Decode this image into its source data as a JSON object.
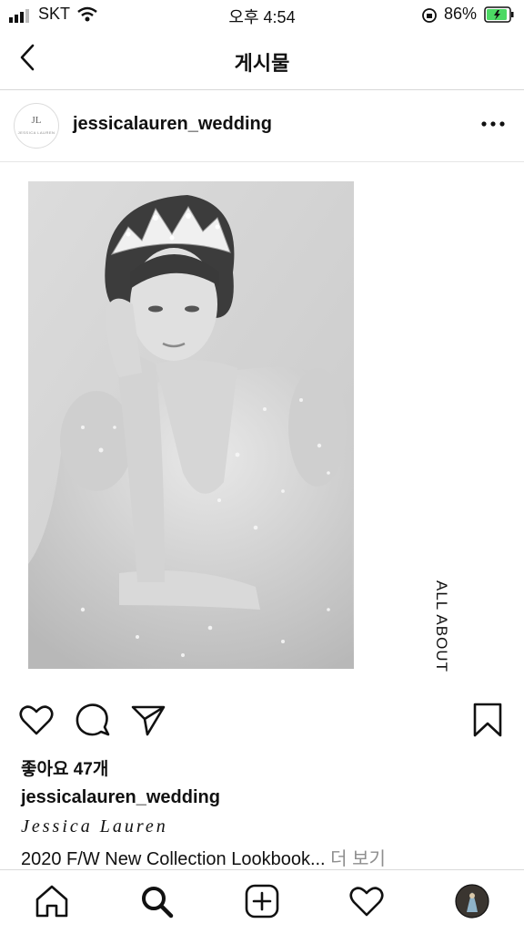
{
  "status_bar": {
    "carrier": "SKT",
    "time": "오후 4:54",
    "battery": "86%"
  },
  "nav": {
    "title": "게시물",
    "back_icon": "chevron-left-icon"
  },
  "post": {
    "username": "jessicalauren_wedding",
    "avatar_monogram": "JL",
    "avatar_subtext": "JESSICA LAUREN",
    "more_icon": "ellipsis-icon",
    "image_side_text": "ALL ABOUT",
    "likes": "좋아요 47개",
    "caption_username": "jessicalauren_wedding",
    "brand_script": "Jessica Lauren",
    "caption": "2020 F/W New Collection Lookbook...",
    "more_label": "더 보기"
  },
  "actions": [
    "heart-icon",
    "comment-icon",
    "share-icon",
    "bookmark-icon"
  ],
  "tabs": [
    "home-icon",
    "search-icon",
    "add-icon",
    "activity-icon",
    "profile-avatar"
  ],
  "colors": {
    "text": "#111111",
    "muted": "#8e8e8e",
    "battery": "#4cd964"
  }
}
